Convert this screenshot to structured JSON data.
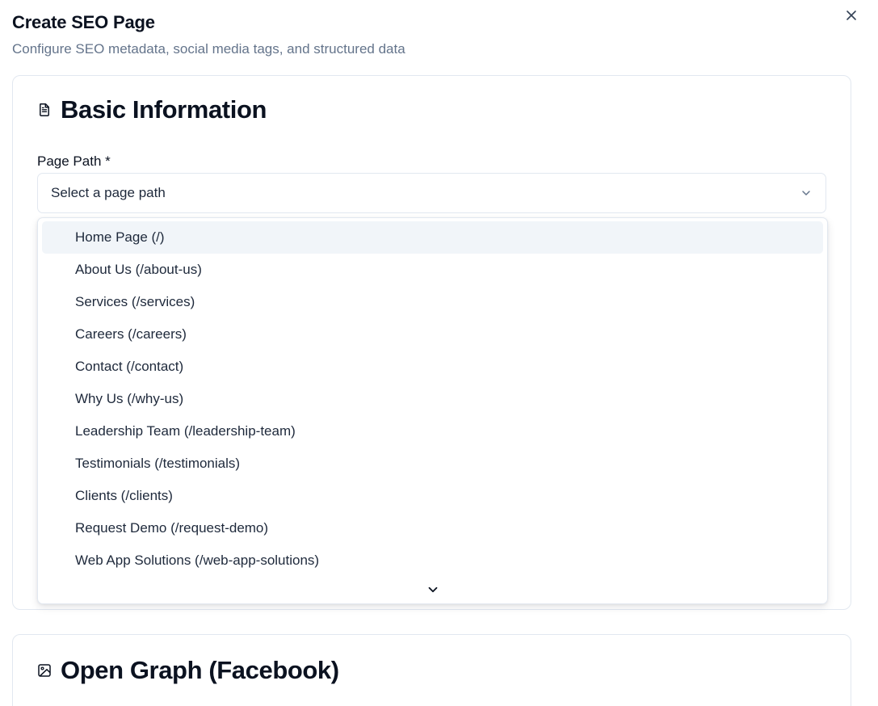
{
  "dialog": {
    "title": "Create SEO Page",
    "subtitle": "Configure SEO metadata, social media tags, and structured data",
    "close_icon": "close-icon"
  },
  "basic_info": {
    "icon": "file-text-icon",
    "title": "Basic Information",
    "page_path": {
      "label": "Page Path *",
      "placeholder": "Select a page path",
      "chevron_icon": "chevron-down-icon"
    }
  },
  "dropdown": {
    "highlighted_index": 0,
    "options": [
      "Home Page (/)",
      "About Us (/about-us)",
      "Services (/services)",
      "Careers (/careers)",
      "Contact (/contact)",
      "Why Us (/why-us)",
      "Leadership Team (/leadership-team)",
      "Testimonials (/testimonials)",
      "Clients (/clients)",
      "Request Demo (/request-demo)",
      "Web App Solutions (/web-app-solutions)"
    ],
    "scroll_icon": "chevron-down-icon"
  },
  "open_graph": {
    "icon": "image-icon",
    "title": "Open Graph (Facebook)"
  },
  "colors": {
    "text_primary": "#0b1220",
    "text_muted": "#64748b",
    "border": "#e2e8f0",
    "highlight": "#f1f5f9"
  }
}
